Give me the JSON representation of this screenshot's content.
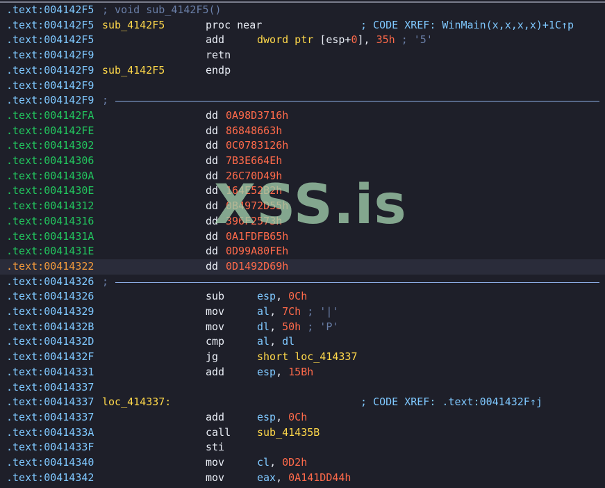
{
  "colors": {
    "background": "#1e1f29",
    "code_address": "#7fc8ff",
    "data_address": "#22c55e",
    "current_line_address": "#f29a3c",
    "label": "#ffd84a",
    "number": "#ff6a4a",
    "comment": "#6a7fa8"
  },
  "watermark": "XSS.is",
  "listing": [
    {
      "seg": ".text:",
      "addr": "004142F5",
      "kind": "code",
      "comment": "; void sub_4142F5()"
    },
    {
      "seg": ".text:",
      "addr": "004142F5",
      "kind": "code",
      "label": "sub_4142F5",
      "mnem": "proc near",
      "xref": "; CODE XREF: WinMain(x,x,x,x)+1C↑p"
    },
    {
      "seg": ".text:",
      "addr": "004142F5",
      "kind": "code",
      "mnem": "add",
      "op1": "dword ptr",
      "op2": "[esp+",
      "op3": "0",
      "op4": "], ",
      "op5": "35h",
      "op6": " ; '5'"
    },
    {
      "seg": ".text:",
      "addr": "004142F9",
      "kind": "code",
      "mnem": "retn"
    },
    {
      "seg": ".text:",
      "addr": "004142F9",
      "kind": "code",
      "label": "sub_4142F5",
      "mnem": "endp"
    },
    {
      "seg": ".text:",
      "addr": "004142F9",
      "kind": "code"
    },
    {
      "seg": ".text:",
      "addr": "004142F9",
      "kind": "code",
      "semi": ";"
    },
    {
      "seg": ".text:",
      "addr": "004142FA",
      "kind": "data",
      "mnem": "dd",
      "value": "0A98D3716h"
    },
    {
      "seg": ".text:",
      "addr": "004142FE",
      "kind": "data",
      "mnem": "dd",
      "value": "86848663h"
    },
    {
      "seg": ".text:",
      "addr": "00414302",
      "kind": "data",
      "mnem": "dd",
      "value": "0C0783126h"
    },
    {
      "seg": ".text:",
      "addr": "00414306",
      "kind": "data",
      "mnem": "dd",
      "value": "7B3E664Eh"
    },
    {
      "seg": ".text:",
      "addr": "0041430A",
      "kind": "data",
      "mnem": "dd",
      "value": "26C70D49h"
    },
    {
      "seg": ".text:",
      "addr": "0041430E",
      "kind": "data",
      "mnem": "dd",
      "value": "164E52B2h"
    },
    {
      "seg": ".text:",
      "addr": "00414312",
      "kind": "data",
      "mnem": "dd",
      "value": "0B4972D55h"
    },
    {
      "seg": ".text:",
      "addr": "00414316",
      "kind": "data",
      "mnem": "dd",
      "value": "396F2573h"
    },
    {
      "seg": ".text:",
      "addr": "0041431A",
      "kind": "data",
      "mnem": "dd",
      "value": "0A1FDFB65h"
    },
    {
      "seg": ".text:",
      "addr": "0041431E",
      "kind": "data",
      "mnem": "dd",
      "value": "0D99A80FEh"
    },
    {
      "seg": ".text:",
      "addr": "00414322",
      "kind": "current",
      "mnem": "dd",
      "value": "0D1492D69h"
    },
    {
      "seg": ".text:",
      "addr": "00414326",
      "kind": "code",
      "semi": ";"
    },
    {
      "seg": ".text:",
      "addr": "00414326",
      "kind": "code",
      "mnem": "sub",
      "a": "esp",
      "b": "0Ch"
    },
    {
      "seg": ".text:",
      "addr": "00414329",
      "kind": "code",
      "mnem": "mov",
      "a": "al",
      "b": "7Ch",
      "c": "; '|'"
    },
    {
      "seg": ".text:",
      "addr": "0041432B",
      "kind": "code",
      "mnem": "mov",
      "a": "dl",
      "b": "50h",
      "c": "; 'P'"
    },
    {
      "seg": ".text:",
      "addr": "0041432D",
      "kind": "code",
      "mnem": "cmp",
      "a": "al",
      "breg": "dl"
    },
    {
      "seg": ".text:",
      "addr": "0041432F",
      "kind": "code",
      "mnem": "jg",
      "a": "short",
      "target": "loc_414337"
    },
    {
      "seg": ".text:",
      "addr": "00414331",
      "kind": "code",
      "mnem": "add",
      "a": "esp",
      "b": "15Bh"
    },
    {
      "seg": ".text:",
      "addr": "00414337",
      "kind": "code"
    },
    {
      "seg": ".text:",
      "addr": "00414337",
      "kind": "code",
      "label": "loc_414337:",
      "xref": "; CODE XREF: .text:0041432F↑j"
    },
    {
      "seg": ".text:",
      "addr": "00414337",
      "kind": "code",
      "mnem": "add",
      "a": "esp",
      "b": "0Ch"
    },
    {
      "seg": ".text:",
      "addr": "0041433A",
      "kind": "code",
      "mnem": "call",
      "target": "sub_41435B"
    },
    {
      "seg": ".text:",
      "addr": "0041433F",
      "kind": "code",
      "mnem": "sti"
    },
    {
      "seg": ".text:",
      "addr": "00414340",
      "kind": "code",
      "mnem": "mov",
      "a": "cl",
      "b": "0D2h"
    },
    {
      "seg": ".text:",
      "addr": "00414342",
      "kind": "code",
      "mnem": "mov",
      "a": "eax",
      "b": "0A141DD44h"
    }
  ]
}
